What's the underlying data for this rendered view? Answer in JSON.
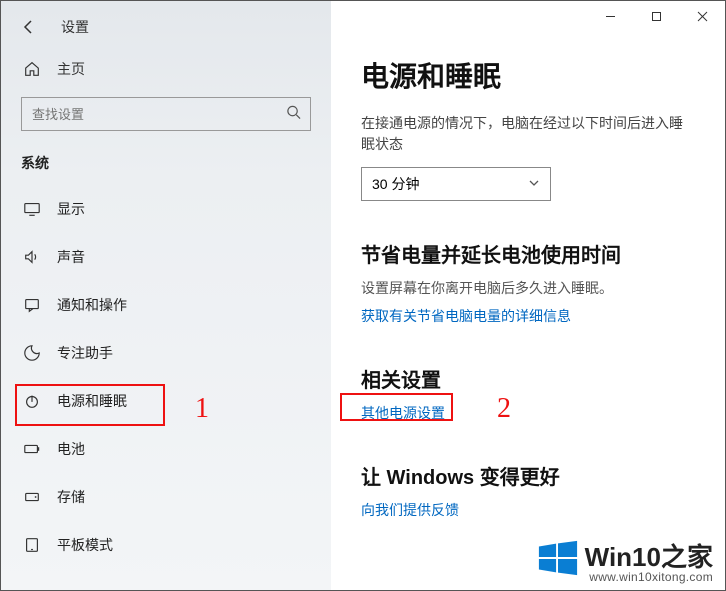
{
  "titlebar": {
    "title": "设置"
  },
  "home": {
    "label": "主页"
  },
  "search": {
    "placeholder": "查找设置"
  },
  "category": {
    "label": "系统"
  },
  "sidebar": {
    "items": [
      {
        "label": "显示",
        "icon": "display"
      },
      {
        "label": "声音",
        "icon": "sound"
      },
      {
        "label": "通知和操作",
        "icon": "notify"
      },
      {
        "label": "专注助手",
        "icon": "focus"
      },
      {
        "label": "电源和睡眠",
        "icon": "power"
      },
      {
        "label": "电池",
        "icon": "battery"
      },
      {
        "label": "存储",
        "icon": "storage"
      },
      {
        "label": "平板模式",
        "icon": "tablet"
      }
    ]
  },
  "page": {
    "title": "电源和睡眠",
    "sleep_desc": "在接通电源的情况下，电脑在经过以下时间后进入睡眠状态",
    "sleep_select": "30 分钟",
    "battery_title": "节省电量并延长电池使用时间",
    "battery_hint": "设置屏幕在你离开电脑后多久进入睡眠。",
    "battery_link": "获取有关节省电脑电量的详细信息",
    "related_title": "相关设置",
    "related_link": "其他电源设置",
    "feedback_title": "让 Windows 变得更好",
    "feedback_link": "向我们提供反馈"
  },
  "annotations": {
    "n1": "1",
    "n2": "2"
  },
  "watermark": {
    "brand": "Win10",
    "suffix": "之家",
    "url": "www.win10xitong.com"
  }
}
